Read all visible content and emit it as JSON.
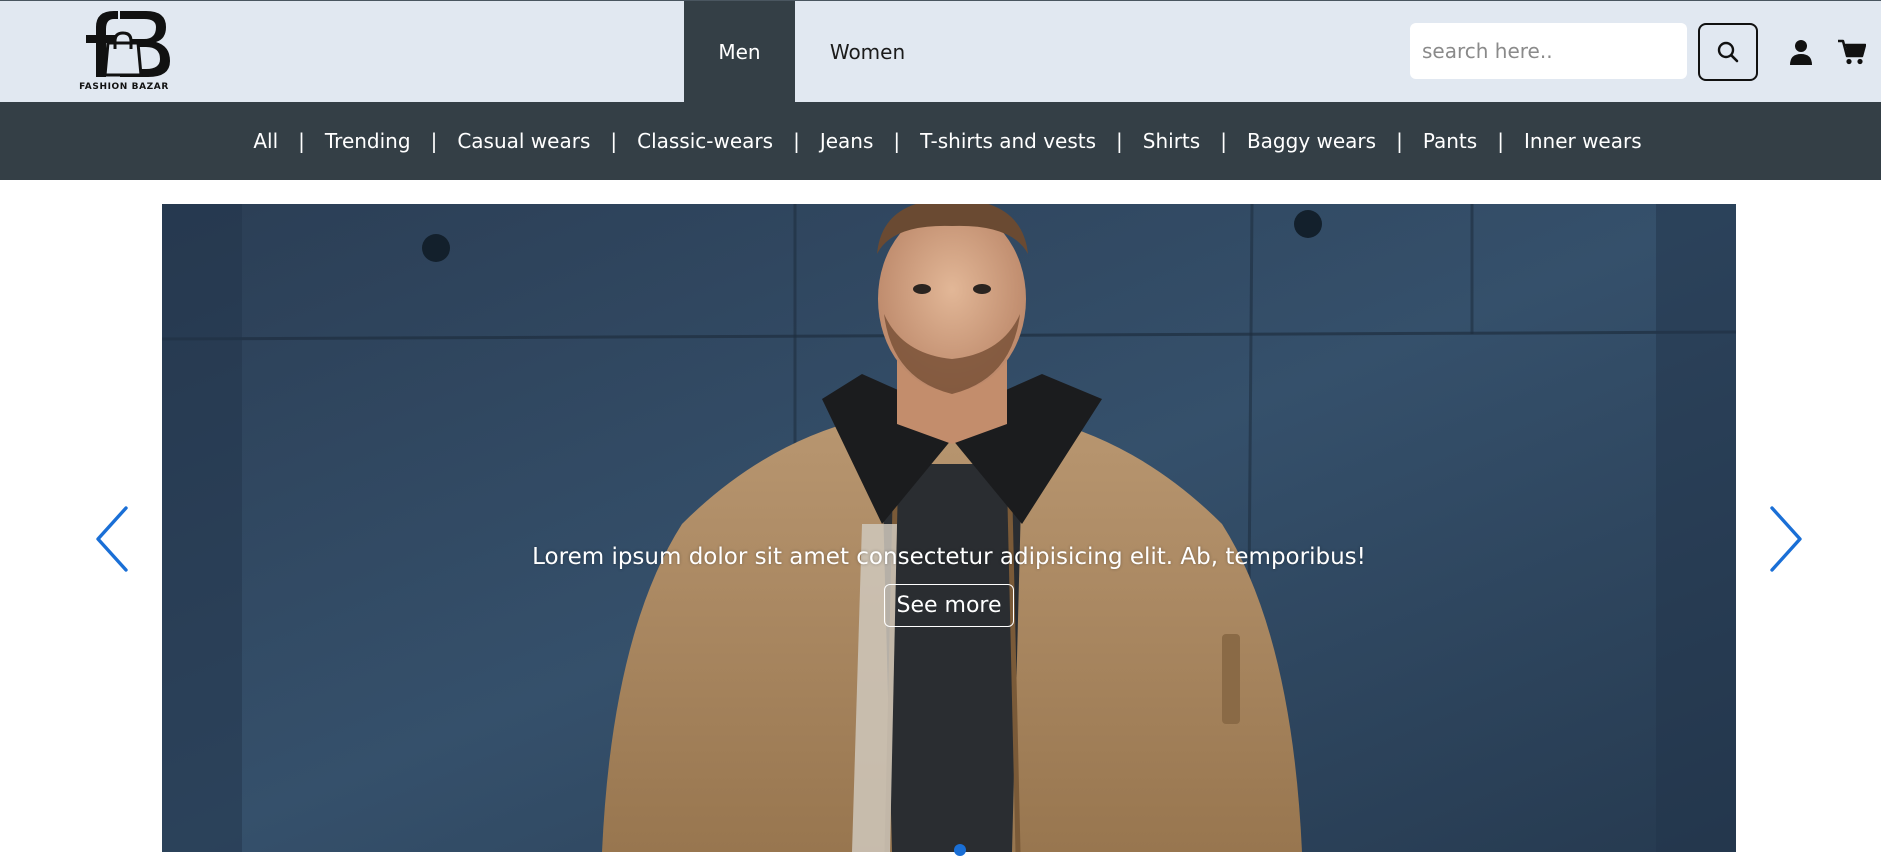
{
  "header": {
    "logo_text": "FASHION BAZAR",
    "logo_monogram": "fB",
    "gender_tabs": [
      {
        "label": "Men",
        "active": true
      },
      {
        "label": "Women",
        "active": false
      }
    ],
    "search": {
      "placeholder": "search here.."
    },
    "icons": {
      "search": "search-icon",
      "user": "user-icon",
      "cart": "cart-icon"
    }
  },
  "categories": [
    "All",
    "Trending",
    "Casual wears",
    "Classic-wears",
    "Jeans",
    "T-shirts and vests",
    "Shirts",
    "Baggy wears",
    "Pants",
    "Inner wears"
  ],
  "category_separator": "|",
  "hero": {
    "caption": "Lorem ipsum dolor sit amet consectetur adipisicing elit. Ab, temporibus!",
    "button_label": "See more",
    "prev_icon": "chevron-left-icon",
    "next_icon": "chevron-right-icon",
    "image_alt": "man-in-tan-jacket-photo"
  },
  "colors": {
    "header_bg": "#e1e8f1",
    "nav_dark": "#343f46",
    "accent_blue": "#1a6fd6"
  }
}
